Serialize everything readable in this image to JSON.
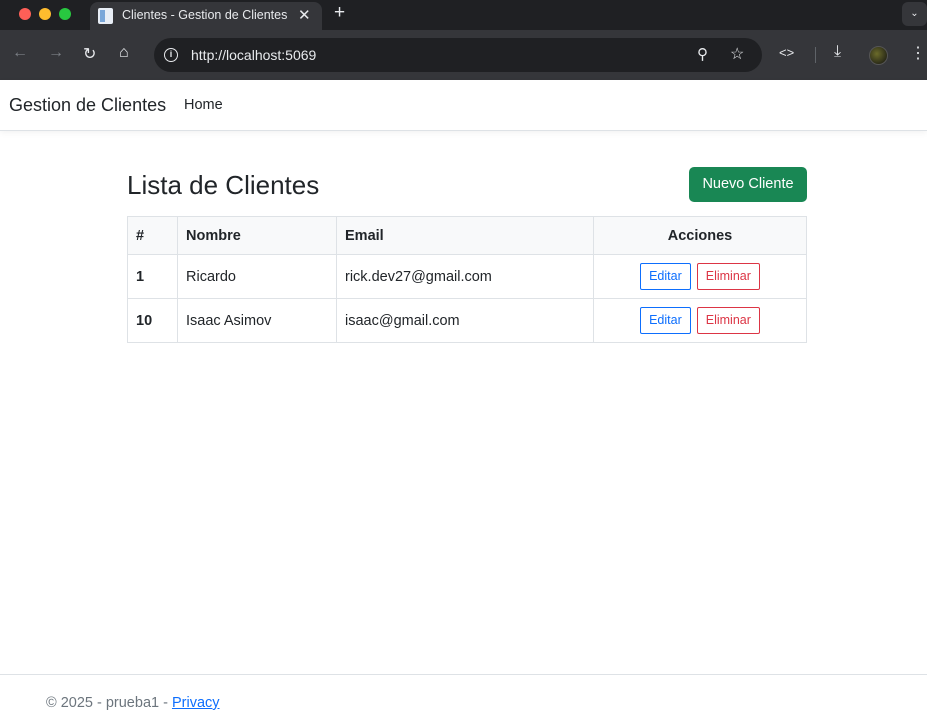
{
  "browser": {
    "tab_title": "Clientes - Gestion de Clientes",
    "tab_close": "✕",
    "new_tab": "+",
    "url": "http://localhost:5069",
    "icons": [
      "back-arrow-icon",
      "forward-arrow-icon",
      "reload-icon",
      "home-icon",
      "site-info-icon",
      "zoom-icon",
      "bookmark-star-icon",
      "code-icon",
      "download-icon",
      "profile-avatar-icon",
      "menu-dots-icon"
    ]
  },
  "navbar": {
    "brand": "Gestion de Clientes",
    "home": "Home"
  },
  "main": {
    "title": "Lista de Clientes",
    "new_button": "Nuevo Cliente",
    "table": {
      "headers": [
        "#",
        "Nombre",
        "Email",
        "Acciones"
      ],
      "rows": [
        {
          "id": "1",
          "name": "Ricardo",
          "email": "rick.dev27@gmail.com",
          "edit": "Editar",
          "delete": "Eliminar"
        },
        {
          "id": "10",
          "name": "Isaac Asimov",
          "email": "isaac@gmail.com",
          "edit": "Editar",
          "delete": "Eliminar"
        }
      ]
    }
  },
  "footer": {
    "text": "© 2025 - prueba1 - ",
    "link": "Privacy"
  },
  "colors": {
    "success": "#198754",
    "primary": "#0d6efd",
    "danger": "#dc3545"
  }
}
